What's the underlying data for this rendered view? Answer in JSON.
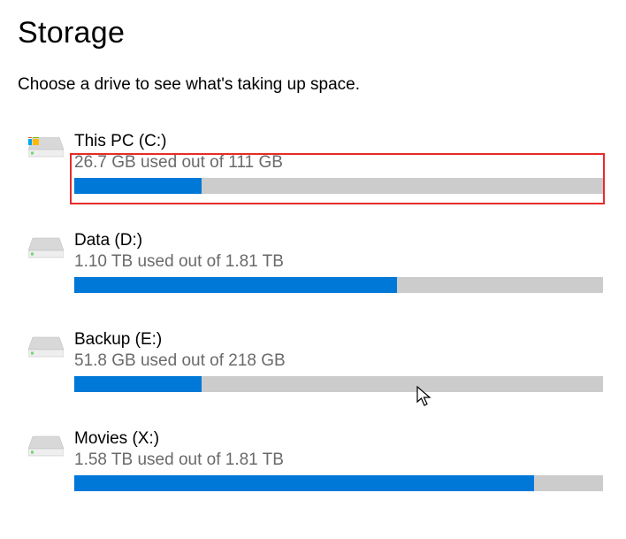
{
  "page": {
    "title": "Storage",
    "subtitle": "Choose a drive to see what's taking up space."
  },
  "drives": [
    {
      "name": "This PC (C:)",
      "usage_text": "26.7 GB used out of 111 GB",
      "used_value": 26.7,
      "total_value": 111,
      "fill_percent": 24,
      "icon": "system-drive",
      "highlighted": true
    },
    {
      "name": "Data (D:)",
      "usage_text": "1.10 TB used out of 1.81 TB",
      "used_value": 1.1,
      "total_value": 1.81,
      "fill_percent": 61,
      "icon": "drive",
      "highlighted": false
    },
    {
      "name": "Backup (E:)",
      "usage_text": "51.8 GB used out of 218 GB",
      "used_value": 51.8,
      "total_value": 218,
      "fill_percent": 24,
      "icon": "drive",
      "highlighted": false
    },
    {
      "name": "Movies (X:)",
      "usage_text": "1.58 TB used out of 1.81 TB",
      "used_value": 1.58,
      "total_value": 1.81,
      "fill_percent": 87,
      "icon": "drive",
      "highlighted": false
    }
  ]
}
